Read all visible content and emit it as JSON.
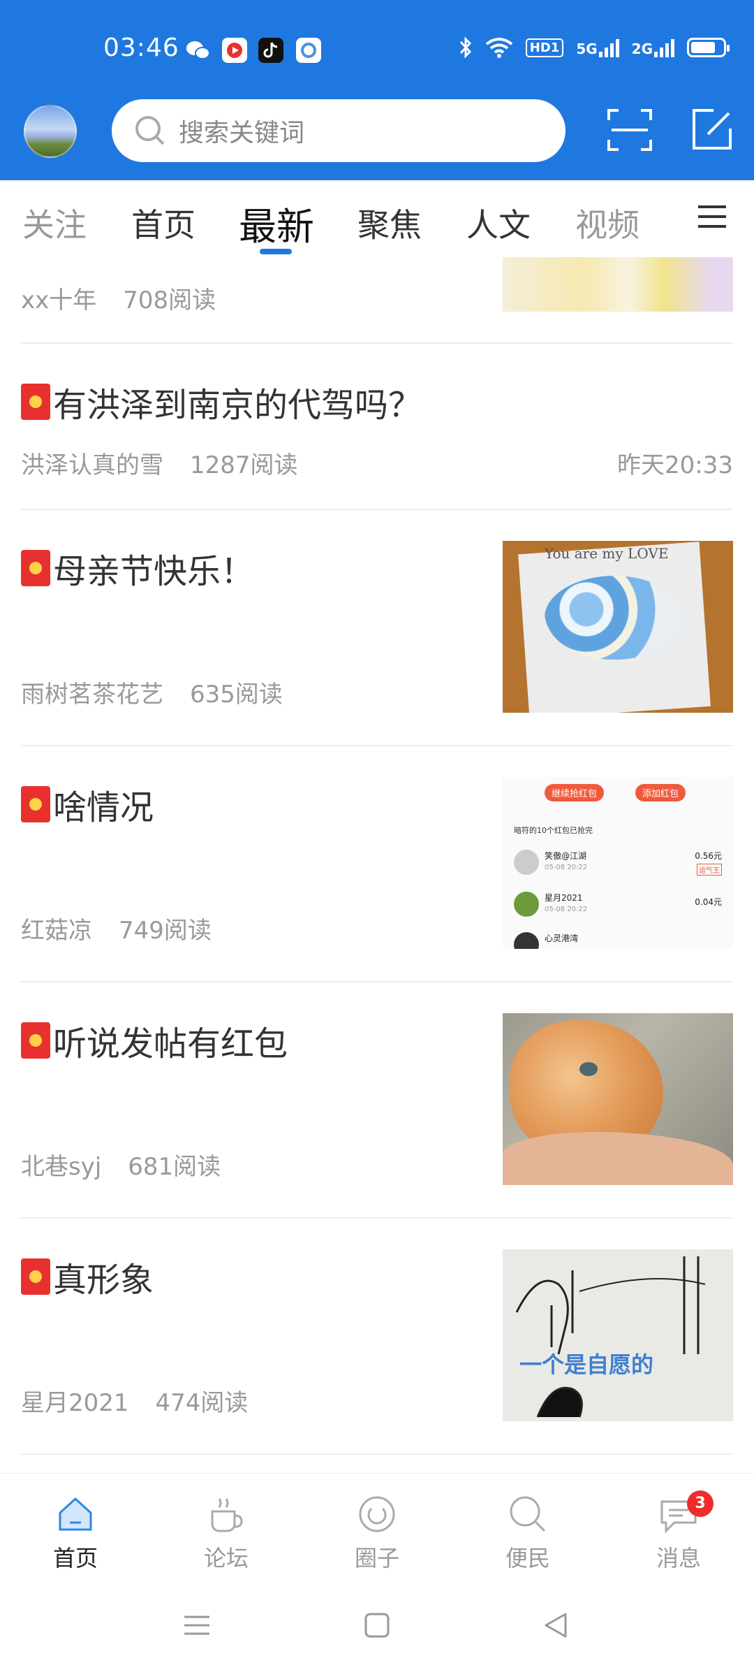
{
  "status_bar": {
    "time": "03:46",
    "network_1": "5G",
    "network_2": "2G",
    "hd_label": "HD1"
  },
  "header": {
    "search_placeholder": "搜索关键词"
  },
  "tabs": [
    {
      "label": "关注"
    },
    {
      "label": "首页"
    },
    {
      "label": "最新"
    },
    {
      "label": "聚焦"
    },
    {
      "label": "人文"
    },
    {
      "label": "视频"
    }
  ],
  "posts": [
    {
      "title": "",
      "author": "xx十年",
      "reads": "708阅读"
    },
    {
      "title": "有洪泽到南京的代驾吗？",
      "author": "洪泽认真的雪",
      "reads": "1287阅读",
      "time": "昨天20:33"
    },
    {
      "title": "母亲节快乐！",
      "author": "雨树茗茶花艺",
      "reads": "635阅读",
      "image_caption": "You are my LOVE"
    },
    {
      "title": "啥情况",
      "author": "红菇凉",
      "reads": "749阅读",
      "image": {
        "btn1": "继续抢红包",
        "btn2": "添加红包",
        "header": "暗符的10个红包已抢完",
        "rows": [
          {
            "name": "笑傲@江湖",
            "date": "05-08 20:22",
            "amount": "0.56元",
            "tag": "运气王"
          },
          {
            "name": "星月2021",
            "date": "05-08 20:22",
            "amount": "0.04元",
            "tag": ""
          },
          {
            "name": "心灵港湾",
            "date": "",
            "amount": "",
            "tag": ""
          }
        ]
      }
    },
    {
      "title": "听说发帖有红包",
      "author": "北巷syj",
      "reads": "681阅读"
    },
    {
      "title": "真形象",
      "author": "星月2021",
      "reads": "474阅读",
      "image_caption": "一个是自愿的"
    }
  ],
  "bottom_nav": [
    {
      "label": "首页",
      "icon": "home-icon"
    },
    {
      "label": "论坛",
      "icon": "cup-icon"
    },
    {
      "label": "圈子",
      "icon": "circle-icon"
    },
    {
      "label": "便民",
      "icon": "search-icon"
    },
    {
      "label": "消息",
      "icon": "chat-icon",
      "badge": "3"
    }
  ],
  "colors": {
    "primary": "#1f78e0",
    "badge": "#f02b2b",
    "redpack": "#e8312f"
  }
}
